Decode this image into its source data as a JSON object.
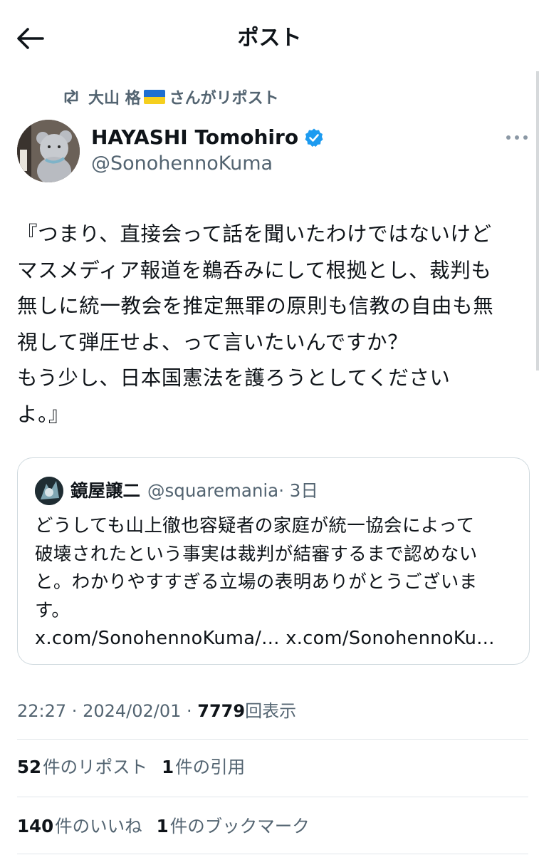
{
  "header": {
    "title": "ポスト"
  },
  "repost_banner": {
    "user": "大山 格",
    "suffix": "さんがリポスト"
  },
  "author": {
    "name": "HAYASHI Tomohiro",
    "handle": "@SonohennoKuma"
  },
  "post": {
    "text": "『つまり、直接会って話を聞いたわけではないけど\nマスメディア報道を鵜呑みにして根拠とし、裁判も\n無しに統一教会を推定無罪の原則も信教の自由も無\n視して弾圧せよ、って言いたいんですか？\nもう少し、日本国憲法を護ろうとしてください\nよ。』"
  },
  "quote": {
    "name": "鏡屋譲二",
    "handle": "@squaremania",
    "time": "· 3日",
    "text": "どうしても山上徹也容疑者の家庭が統一協会によって\n破壊されたという事実は裁判が結審するまで認めない\nと。わかりやすすぎる立場の表明ありがとうございま\nす。\nx.com/SonohennoKuma/... x.com/SonohennoKu..."
  },
  "meta": {
    "time": "22:27",
    "date": "2024/02/01",
    "sep": " · ",
    "views": "7779",
    "views_label": "回表示"
  },
  "stats": {
    "reposts": {
      "count": "52",
      "label": "件のリポスト"
    },
    "quotes": {
      "count": "1",
      "label": "件の引用"
    },
    "likes": {
      "count": "140",
      "label": "件のいいね"
    },
    "bookmarks": {
      "count": "1",
      "label": "件のブックマーク"
    }
  },
  "icons": {
    "back": "arrow-left-icon",
    "repost": "repost-icon",
    "flag": "ukraine-flag-icon",
    "verified": "verified-badge-icon",
    "more": "more-horizontal-icon"
  },
  "colors": {
    "text": "#0f1419",
    "secondary": "#536471",
    "verified": "#1d9bf0",
    "border": "#cfd9de"
  }
}
